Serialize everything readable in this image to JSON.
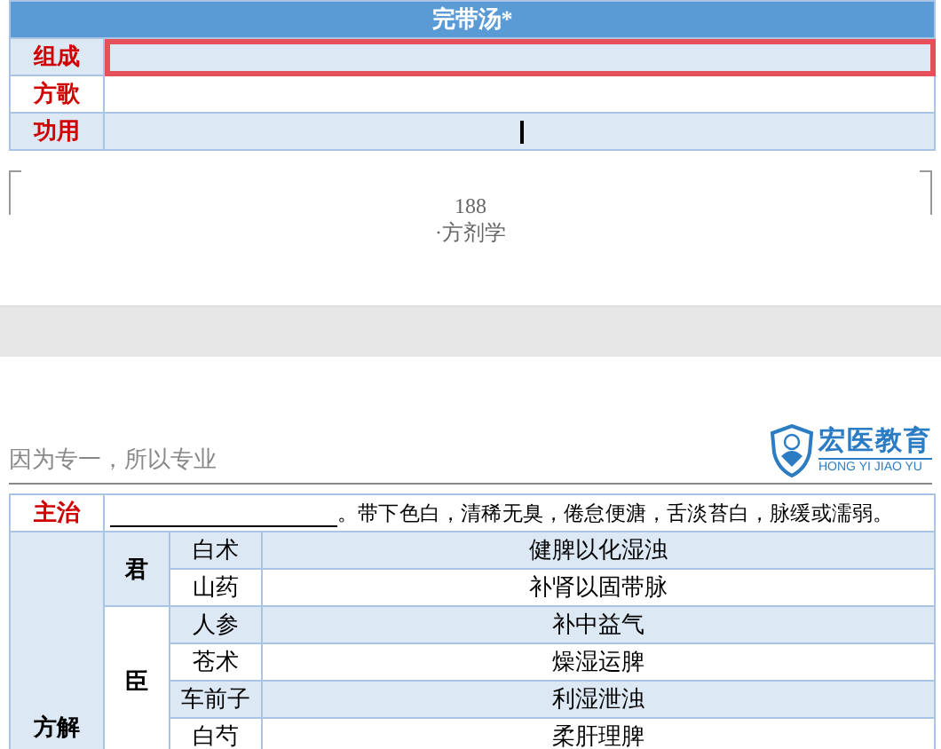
{
  "page1": {
    "table": {
      "title": "完带汤*",
      "rows": [
        {
          "label": "组成",
          "selected": true,
          "cursor": false
        },
        {
          "label": "方歌",
          "selected": false,
          "cursor": false
        },
        {
          "label": "功用",
          "selected": false,
          "cursor": true
        }
      ]
    },
    "footer": {
      "page_number": "188",
      "section": "·方剂学"
    }
  },
  "page2": {
    "header": {
      "motto": "因为专一，所以专业",
      "logo_name": "宏医教育",
      "logo_pinyin": "HONG YI JIAO YU"
    },
    "table": {
      "indications": {
        "label": "主治",
        "text": "。带下色白，清稀无臭，倦怠便溏，舌淡苔白，脉缓或濡弱。"
      },
      "analysis": {
        "label": "方解",
        "groups": [
          {
            "role": "君",
            "herbs": [
              {
                "name": "白术",
                "function": "健脾以化湿浊"
              },
              {
                "name": "山药",
                "function": "补肾以固带脉"
              }
            ]
          },
          {
            "role": "臣",
            "herbs": [
              {
                "name": "人参",
                "function": "补中益气"
              },
              {
                "name": "苍术",
                "function": "燥湿运脾"
              },
              {
                "name": "车前子",
                "function": "利湿泄浊"
              },
              {
                "name": "白芍",
                "function": "柔肝理脾"
              }
            ]
          }
        ]
      }
    }
  }
}
